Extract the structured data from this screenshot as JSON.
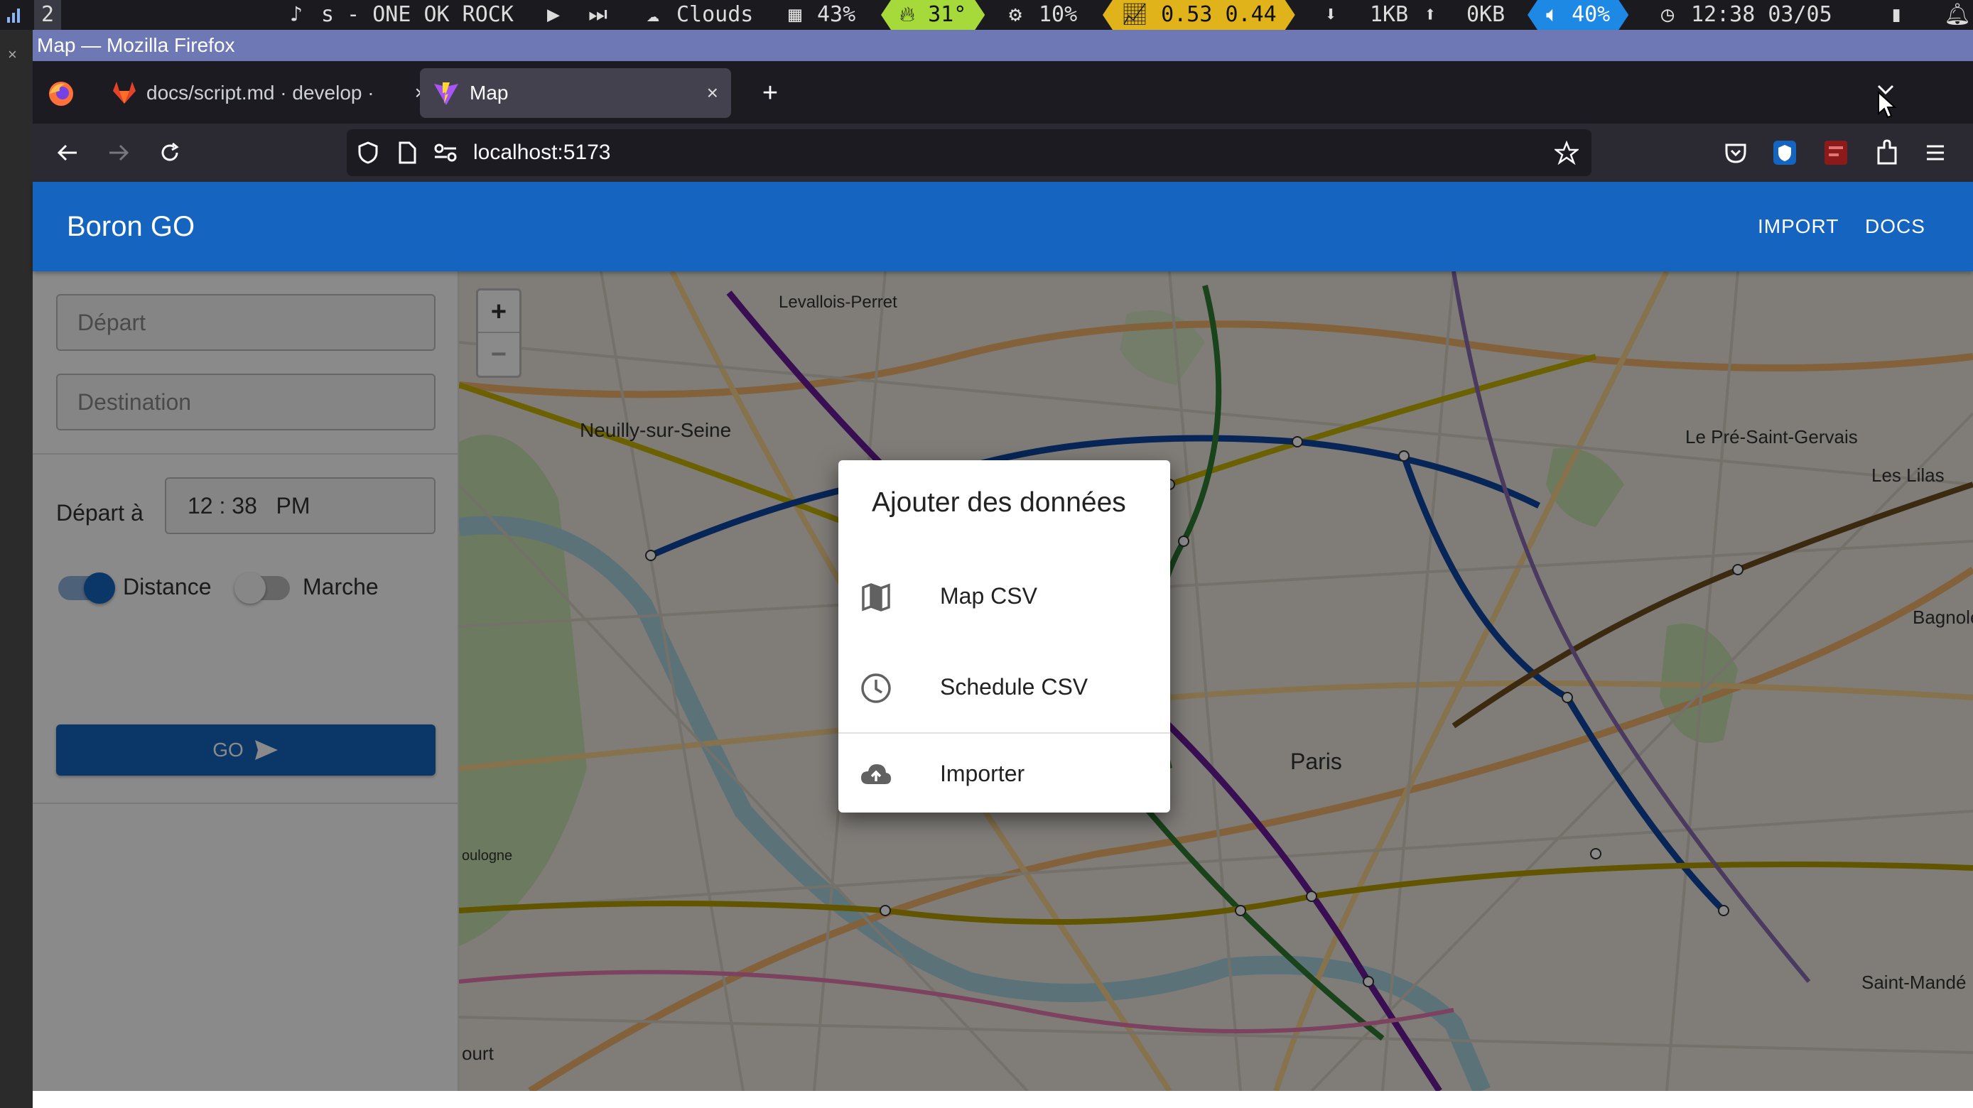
{
  "statusbar": {
    "workspace": "2",
    "music": "s - ONE OK ROCK",
    "weather": "Clouds",
    "mem": "43%",
    "temp": "31°",
    "cpu": "10%",
    "load": "0.53 0.44",
    "down": "1KB",
    "up": "0KB",
    "volume": "40%",
    "clock": "12:38 03/05"
  },
  "window": {
    "title": "Map — Mozilla Firefox",
    "close_glyph": "×"
  },
  "tabs": [
    {
      "label": "docs/script.md · develop ·",
      "icon": "gitlab-icon"
    },
    {
      "label": "Map",
      "icon": "vite-icon"
    }
  ],
  "tab_close": "×",
  "new_tab": "+",
  "url": "localhost:5173",
  "app": {
    "title": "Boron GO",
    "nav": {
      "import": "IMPORT",
      "docs": "DOCS"
    },
    "accent": "#1565c0"
  },
  "form": {
    "depart_placeholder": "Départ",
    "destination_placeholder": "Destination",
    "time_label": "Départ à",
    "time_value": "12 : 38   PM",
    "toggle_distance_label": "Distance",
    "toggle_distance_on": true,
    "toggle_walk_label": "Marche",
    "toggle_walk_on": false,
    "go_label": "GO"
  },
  "map": {
    "zoom_in": "+",
    "zoom_out": "−",
    "labels": {
      "levallois": "Levallois-Perret",
      "neuilly": "Neuilly-sur-Seine",
      "pre": "Le Pré-Saint-Gervais",
      "lilas": "Les Lilas",
      "bagnolet": "Bagnolet",
      "paris": "Paris",
      "mande": "Saint-Mandé",
      "boulogne": "oulogne",
      "court": "ourt"
    }
  },
  "dialog": {
    "title": "Ajouter des données",
    "items": [
      {
        "label": "Map CSV",
        "icon": "map-icon"
      },
      {
        "label": "Schedule CSV",
        "icon": "clock-icon"
      },
      {
        "label": "Importer",
        "icon": "cloud-upload-icon"
      }
    ]
  }
}
